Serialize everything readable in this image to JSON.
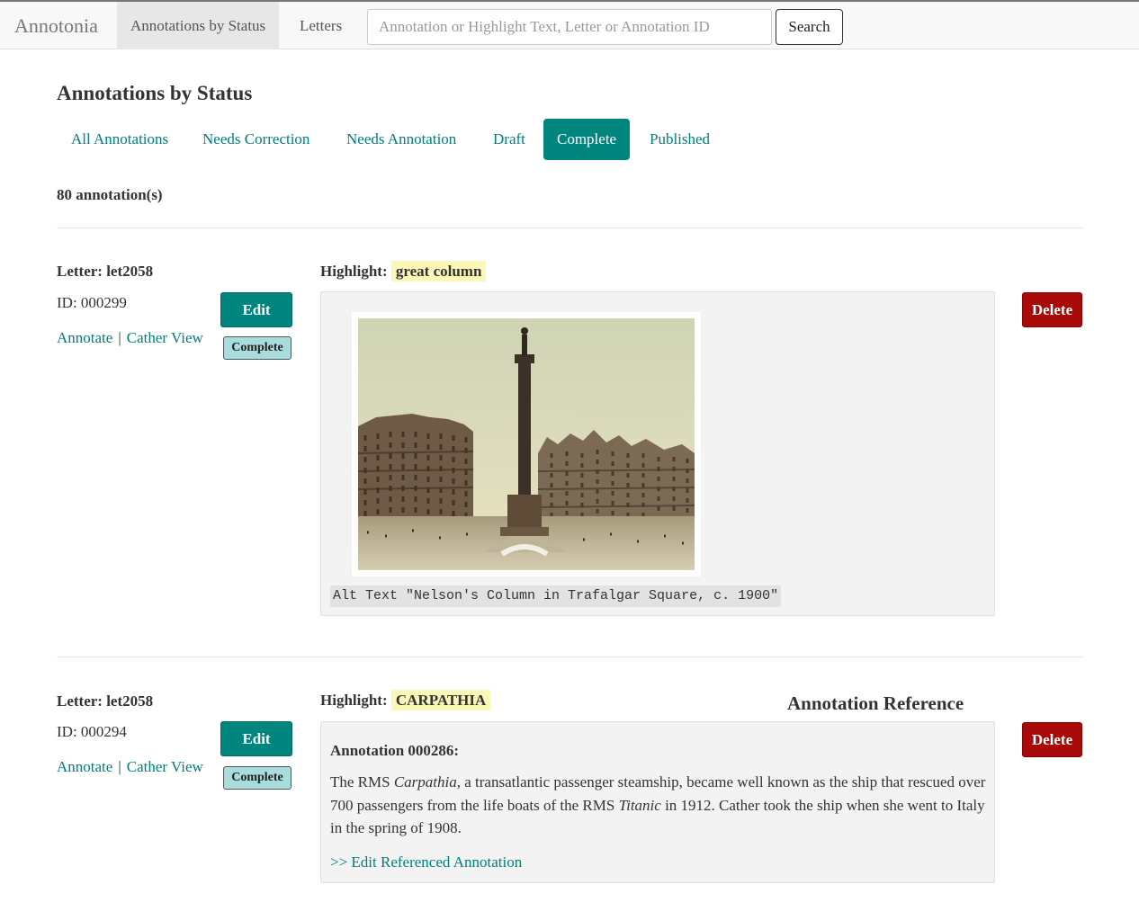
{
  "navbar": {
    "brand": "Annotonia",
    "tabs": [
      {
        "label": "Annotations by Status",
        "active": true
      },
      {
        "label": "Letters",
        "active": false
      }
    ],
    "search_placeholder": "Annotation or Highlight Text, Letter or Annotation ID",
    "search_value": "",
    "search_button": "Search"
  },
  "page": {
    "title": "Annotations by Status",
    "status_tabs": [
      {
        "label": "All Annotations",
        "active": false
      },
      {
        "label": "Needs Correction",
        "active": false
      },
      {
        "label": "Needs Annotation",
        "active": false
      },
      {
        "label": "Draft",
        "active": false
      },
      {
        "label": "Complete",
        "active": true
      },
      {
        "label": "Published",
        "active": false
      }
    ],
    "count": "80 annotation(s)"
  },
  "entries": [
    {
      "letter": "Letter: let2058",
      "id": "ID: 000299",
      "annotate_link": "Annotate",
      "separator": "|",
      "cather_link": "Cather View",
      "edit_label": "Edit",
      "status_badge": "Complete",
      "highlight_label": "Highlight:",
      "highlight_text": "great column",
      "alt_text": "Alt Text \"Nelson's Column in Trafalgar Square, c. 1900\"",
      "delete_label": "Delete"
    },
    {
      "letter": "Letter: let2058",
      "id": "ID: 000294",
      "annotate_link": "Annotate",
      "separator": "|",
      "cather_link": "Cather View",
      "edit_label": "Edit",
      "status_badge": "Complete",
      "highlight_label": "Highlight:",
      "highlight_text": "CARPATHIA",
      "reference_heading": "Annotation Reference",
      "annotation_title": "Annotation 000286:",
      "body_1": "The RMS ",
      "body_em_1": "Carpathia",
      "body_2": ", a transatlantic passenger steamship, became well known as the ship that rescued over 700 passengers from the life boats of the RMS ",
      "body_em_2": "Titanic",
      "body_3": " in 1912. Cather took the ship when she went to Italy in the spring of 1908.",
      "edit_ref_link": ">> Edit Referenced Annotation",
      "delete_label": "Delete"
    }
  ],
  "colors": {
    "accent": "#00857f",
    "link": "#00807d",
    "danger": "#a80a0a",
    "highlight": "#fbf7b7",
    "badge": "#a9dcdc"
  }
}
